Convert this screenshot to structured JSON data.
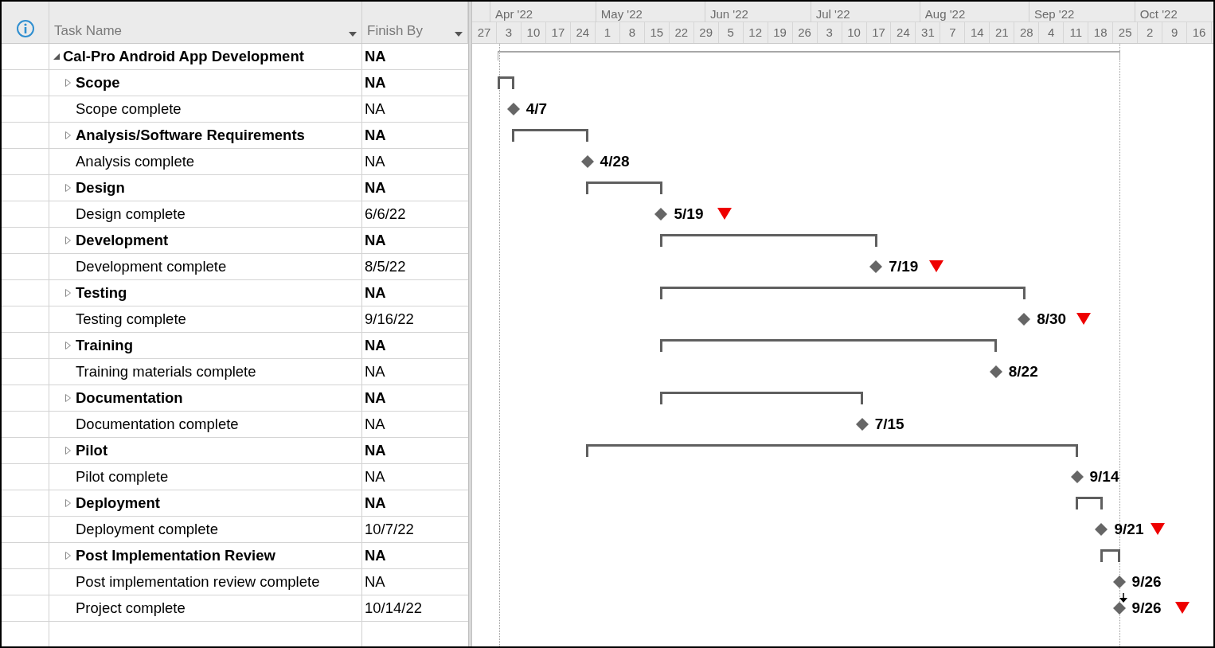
{
  "table": {
    "columns": [
      "Task Name",
      "Finish By"
    ]
  },
  "timescale": {
    "months": [
      "Apr '22",
      "May '22",
      "Jun '22",
      "Jul '22",
      "Aug '22",
      "Sep '22",
      "Oct '22"
    ],
    "weeks": [
      "27",
      "3",
      "10",
      "17",
      "24",
      "1",
      "8",
      "15",
      "22",
      "29",
      "5",
      "12",
      "19",
      "26",
      "3",
      "10",
      "17",
      "24",
      "31",
      "7",
      "14",
      "21",
      "28",
      "4",
      "11",
      "18",
      "25",
      "2",
      "9",
      "16"
    ]
  },
  "tasks": [
    {
      "kind": "project",
      "name": "Cal-Pro Android App Development",
      "finish_by": "NA",
      "expanded": true,
      "children": [
        {
          "kind": "summary",
          "name": "Scope",
          "finish_by": "NA",
          "expanded": false
        },
        {
          "kind": "milestone",
          "name": "Scope complete",
          "finish_by": "NA",
          "date_label": "4/7"
        },
        {
          "kind": "summary",
          "name": "Analysis/Software Requirements",
          "finish_by": "NA",
          "expanded": false
        },
        {
          "kind": "milestone",
          "name": "Analysis complete",
          "finish_by": "NA",
          "date_label": "4/28"
        },
        {
          "kind": "summary",
          "name": "Design",
          "finish_by": "NA",
          "expanded": false
        },
        {
          "kind": "milestone",
          "name": "Design complete",
          "finish_by": "6/6/22",
          "date_label": "5/19"
        },
        {
          "kind": "summary",
          "name": "Development",
          "finish_by": "NA",
          "expanded": false
        },
        {
          "kind": "milestone",
          "name": "Development complete",
          "finish_by": "8/5/22",
          "date_label": "7/19"
        },
        {
          "kind": "summary",
          "name": "Testing",
          "finish_by": "NA",
          "expanded": false
        },
        {
          "kind": "milestone",
          "name": "Testing complete",
          "finish_by": "9/16/22",
          "date_label": "8/30"
        },
        {
          "kind": "summary",
          "name": "Training",
          "finish_by": "NA",
          "expanded": false
        },
        {
          "kind": "milestone",
          "name": "Training materials complete",
          "finish_by": "NA",
          "date_label": "8/22"
        },
        {
          "kind": "summary",
          "name": "Documentation",
          "finish_by": "NA",
          "expanded": false
        },
        {
          "kind": "milestone",
          "name": "Documentation complete",
          "finish_by": "NA",
          "date_label": "7/15"
        },
        {
          "kind": "summary",
          "name": "Pilot",
          "finish_by": "NA",
          "expanded": false
        },
        {
          "kind": "milestone",
          "name": "Pilot complete",
          "finish_by": "NA",
          "date_label": "9/14"
        },
        {
          "kind": "summary",
          "name": "Deployment",
          "finish_by": "NA",
          "expanded": false
        },
        {
          "kind": "milestone",
          "name": "Deployment complete",
          "finish_by": "10/7/22",
          "date_label": "9/21"
        },
        {
          "kind": "summary",
          "name": "Post Implementation Review",
          "finish_by": "NA",
          "expanded": false
        },
        {
          "kind": "milestone",
          "name": "Post implementation review complete",
          "finish_by": "NA",
          "date_label": "9/26"
        },
        {
          "kind": "milestone",
          "name": "Project complete",
          "finish_by": "10/14/22",
          "date_label": "9/26",
          "linked_from_previous": true
        }
      ]
    }
  ]
}
